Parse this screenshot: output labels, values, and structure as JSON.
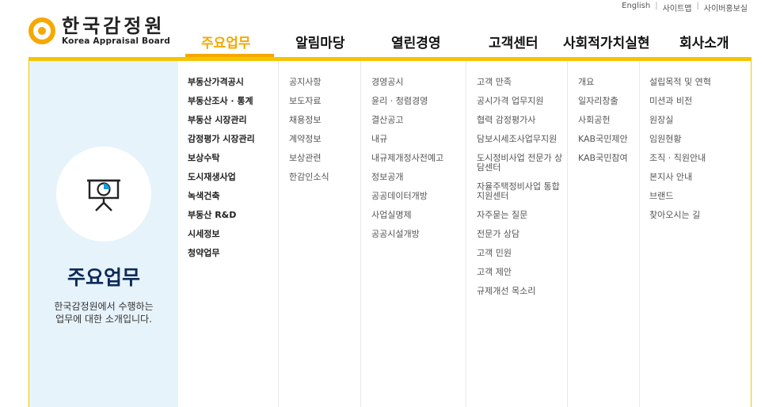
{
  "utility": {
    "english": "English",
    "sitemap": "사이트맵",
    "cyber": "사이버홍보실"
  },
  "logo": {
    "korean": "한국감정원",
    "english": "Korea Appraisal Board"
  },
  "gnb": [
    {
      "label": "주요업무",
      "active": true
    },
    {
      "label": "알림마당",
      "active": false
    },
    {
      "label": "열린경영",
      "active": false
    },
    {
      "label": "고객센터",
      "active": false
    },
    {
      "label": "사회적가치실현",
      "active": false
    },
    {
      "label": "회사소개",
      "active": false
    }
  ],
  "panel": {
    "icon": "presentation-chart-icon",
    "title": "주요업무",
    "description": [
      "한국감정원에서 수행하는",
      "업무에 대한 소개입니다."
    ],
    "accent": "#f5a800",
    "left_bg": "#e7f3fb"
  },
  "menu": {
    "main": [
      "부동산가격공시",
      "부동산조사 · 통계",
      "부동산 시장관리",
      "감정평가 시장관리",
      "보상수탁",
      "도시재생사업",
      "녹색건축",
      "부동산 R&D",
      "시세정보",
      "청약업무"
    ],
    "notice": [
      "공지사항",
      "보도자료",
      "채용정보",
      "계약정보",
      "보상관련",
      "한감인소식"
    ],
    "open": [
      "경영공시",
      "윤리 · 청렴경영",
      "결산공고",
      "내규",
      "내규제개정사전예고",
      "정보공개",
      "공공데이터개방",
      "사업실명제",
      "공공시설개방"
    ],
    "customer": [
      "고객 만족",
      "공시가격 업무지원",
      "협력 감정평가사",
      "담보시세조사업무지원",
      "도시정비사업 전문가 상담센터",
      "자율주택정비사업 통합지원센터",
      "자주묻는 질문",
      "전문가 상담",
      "고객 민원",
      "고객 제안",
      "규제개선 목소리"
    ],
    "social": [
      "개요",
      "일자리창출",
      "사회공헌",
      "KAB국민제안",
      "KAB국민참여"
    ],
    "company": [
      "설립목적 및 연혁",
      "미션과 비전",
      "원장실",
      "임원현황",
      "조직 · 직원안내",
      "본지사 안내",
      "브랜드",
      "찾아오시는 길"
    ]
  }
}
